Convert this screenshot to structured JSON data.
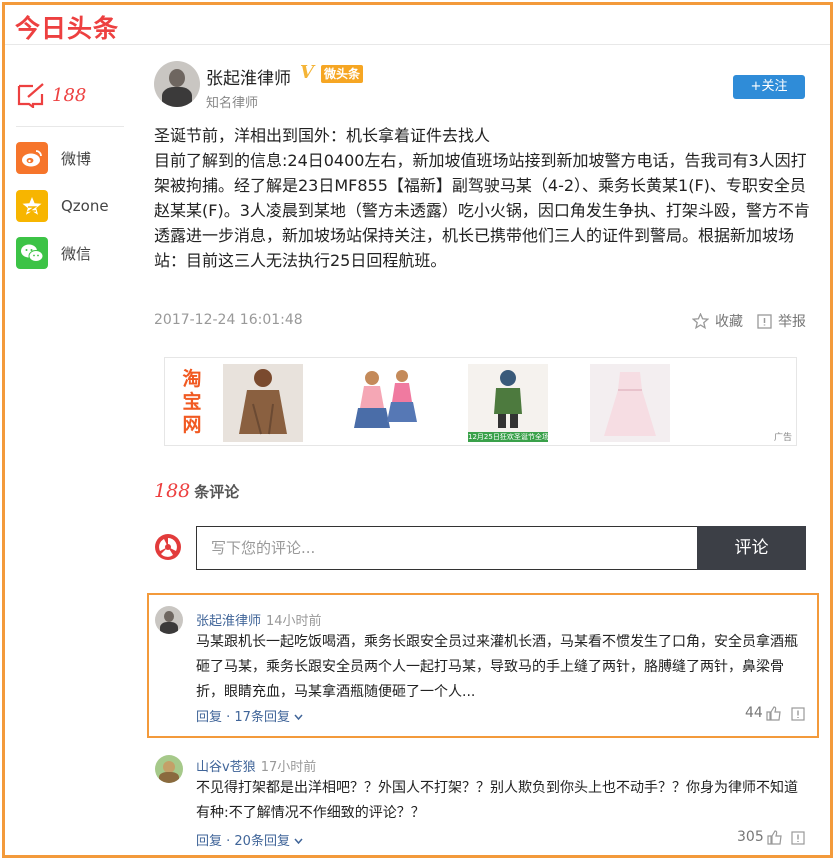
{
  "app": {
    "logo": "今日头条"
  },
  "share": {
    "count": "188",
    "items": [
      {
        "label": "微博",
        "icon": "weibo-icon",
        "color": "#f6752b"
      },
      {
        "label": "Qzone",
        "icon": "qzone-icon",
        "color": "#f7b500"
      },
      {
        "label": "微信",
        "icon": "wechat-icon",
        "color": "#3cc346"
      }
    ]
  },
  "author": {
    "name": "张起淮律师",
    "v": "V",
    "badge": "微头条",
    "title": "知名律师",
    "follow_label": "+关注"
  },
  "article": {
    "paragraphs": [
      "圣诞节前，洋相出到国外：机长拿着证件去找人",
      "目前了解到的信息:24日0400左右，新加坡值班场站接到新加坡警方电话，告我司有3人因打架被拘捕。经了解是23日MF855【福新】副驾驶马某（4-2）、乘务长黄某1(F)、专职安全员赵某某(F)。3人凌晨到某地（警方未透露）吃小火锅，因口角发生争执、打架斗殴，警方不肯透露进一步消息，新加坡场站保持关注，机长已携带他们三人的证件到警局。根据新加坡场站：目前这三人无法执行25日回程航班。"
    ],
    "time": "2017-12-24 16:01:48",
    "favorite_label": "收藏",
    "report_label": "举报"
  },
  "ad": {
    "brand": "淘宝网",
    "caption": "12月25日狂欢圣诞节全场7折",
    "tag": "广告"
  },
  "comments": {
    "count": "188",
    "count_label": "条评论",
    "input_placeholder": "写下您的评论...",
    "submit_label": "评论",
    "list": [
      {
        "user": "张起淮律师",
        "time": "14小时前",
        "text": "马某跟机长一起吃饭喝酒，乘务长跟安全员过来灌机长酒，马某看不惯发生了口角，安全员拿酒瓶砸了马某，乘务长跟安全员两个人一起打马某，导致马的手上缝了两针，胳膊缝了两针，鼻梁骨折，眼睛充血，马某拿酒瓶随便砸了一个人...",
        "reply": "回复 · 17条回复",
        "likes": "44"
      },
      {
        "user": "山谷v苍狼",
        "time": "17小时前",
        "text": "不见得打架都是出洋相吧？？外国人不打架？？别人欺负到你头上也不动手？？你身为律师不知道有种:不了解情况不作细致的评论？？",
        "reply": "回复 · 20条回复",
        "likes": "305"
      }
    ]
  }
}
